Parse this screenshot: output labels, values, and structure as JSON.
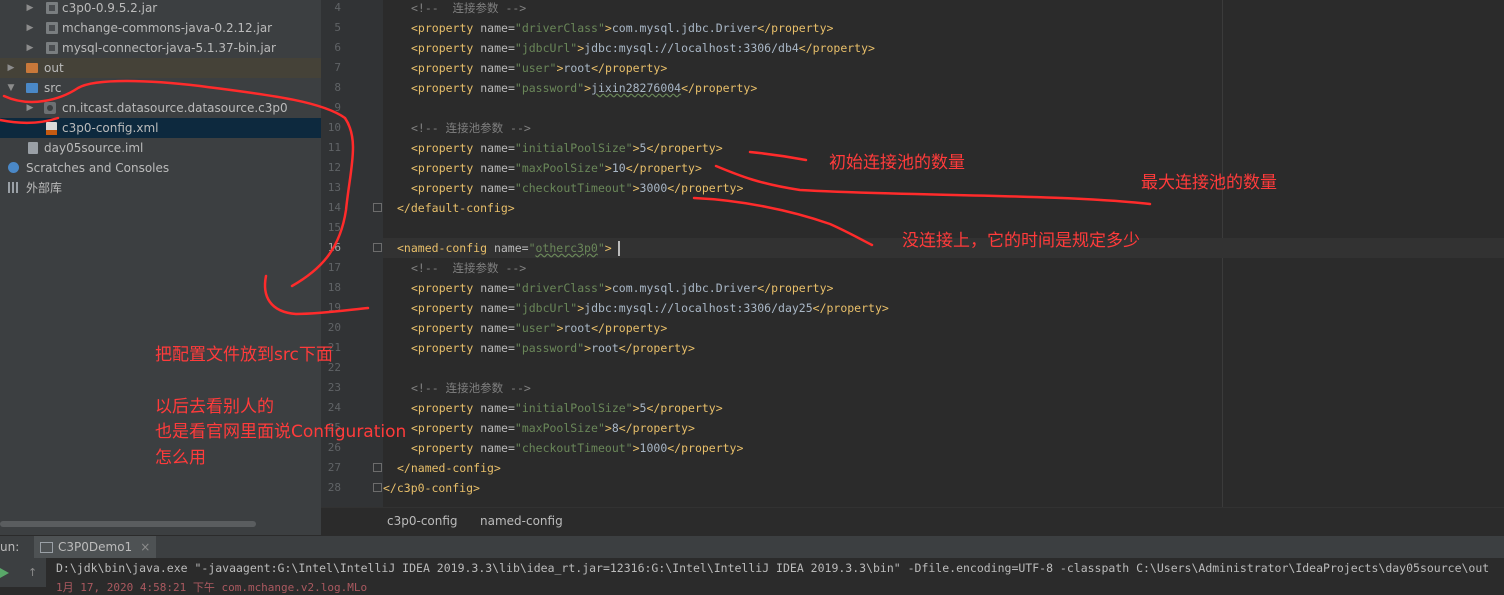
{
  "project_tree": [
    {
      "label": "c3p0-0.9.5.2.jar",
      "icon": "jar-icon",
      "indent": 2
    },
    {
      "label": "mchange-commons-java-0.2.12.jar",
      "icon": "jar-icon",
      "indent": 2
    },
    {
      "label": "mysql-connector-java-5.1.37-bin.jar",
      "icon": "jar-icon",
      "indent": 2
    },
    {
      "label": "out",
      "icon": "folder-icon",
      "indent": 0
    },
    {
      "label": "src",
      "icon": "source-folder-icon",
      "indent": 0
    },
    {
      "label": "cn.itcast.datasource.datasource.c3p0",
      "icon": "package-icon",
      "indent": 1
    },
    {
      "label": "c3p0-config.xml",
      "icon": "xml-file-icon",
      "indent": 1
    },
    {
      "label": "day05source.iml",
      "icon": "iml-file-icon",
      "indent": 0
    },
    {
      "label": "Scratches and Consoles",
      "icon": "scratches-icon",
      "indent": 0
    },
    {
      "label": "外部库",
      "icon": "library-icon",
      "indent": 0
    }
  ],
  "line_numbers": [
    "4",
    "5",
    "6",
    "7",
    "8",
    "9",
    "10",
    "11",
    "12",
    "13",
    "14",
    "15",
    "16",
    "17",
    "18",
    "19",
    "20",
    "21",
    "22",
    "23",
    "24",
    "25",
    "26",
    "27",
    "28"
  ],
  "code": {
    "l4_cmt": "<!--  连接参数 -->",
    "props": {
      "driverClass": "driverClass",
      "jdbcUrl": "jdbcUrl",
      "user": "user",
      "password": "password",
      "initialPoolSize": "initialPoolSize",
      "maxPoolSize": "maxPoolSize",
      "checkoutTimeout": "checkoutTimeout"
    },
    "l5_val": "com.mysql.jdbc.Driver",
    "l6_val": "jdbc:mysql://localhost:3306/db4",
    "l7_val": "root",
    "l8_val": "jixin28276004",
    "l10_cmt": "<!-- 连接池参数 -->",
    "l11_val": "5",
    "l12_val": "10",
    "l13_val": "3000",
    "l14_tag": "</default-config>",
    "l16_name": "otherc3p0",
    "l17_cmt": "<!--  连接参数 -->",
    "l18_val": "com.mysql.jdbc.Driver",
    "l19_val": "jdbc:mysql://localhost:3306/day25",
    "l20_val": "root",
    "l21_val": "root",
    "l23_cmt": "<!-- 连接池参数 -->",
    "l24_val": "5",
    "l25_val": "8",
    "l26_val": "1000",
    "l27_tag": "</named-config>",
    "l28_tag": "</c3p0-config>"
  },
  "breadcrumbs": [
    "c3p0-config",
    "named-config"
  ],
  "run_panel": {
    "label": "un:",
    "tab": "C3P0Demo1",
    "command": "D:\\jdk\\bin\\java.exe \"-javaagent:G:\\Intel\\IntelliJ IDEA 2019.3.3\\lib\\idea_rt.jar=12316:G:\\Intel\\IntelliJ IDEA 2019.3.3\\bin\" -Dfile.encoding=UTF-8 -classpath C:\\Users\\Administrator\\IdeaProjects\\day05source\\out",
    "second_line": "1月 17, 2020 4:58:21 下午 com.mchange.v2.log.MLo"
  },
  "annotations": {
    "initial_pool": "初始连接池的数量",
    "max_pool": "最大连接池的数量",
    "timeout": "没连接上，它的时间是规定多少",
    "put_in_src": "把配置文件放到src下面",
    "later_1": "以后去看别人的",
    "later_2": "也是看官网里面说Configuration",
    "later_3": "怎么用"
  },
  "colors": {
    "annotation": "#ff3b3b",
    "tag": "#e8bf6a",
    "attr_value": "#6a8759",
    "comment": "#808080"
  }
}
